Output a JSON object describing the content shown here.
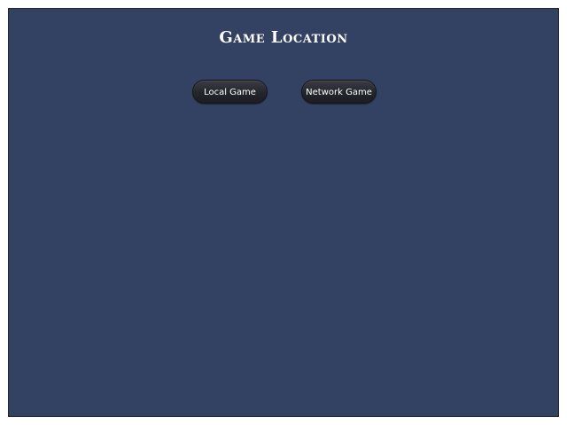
{
  "screen": {
    "title": "Game Location",
    "background_color": "#334262"
  },
  "buttons": {
    "local_label": "Local Game",
    "network_label": "Network Game"
  }
}
